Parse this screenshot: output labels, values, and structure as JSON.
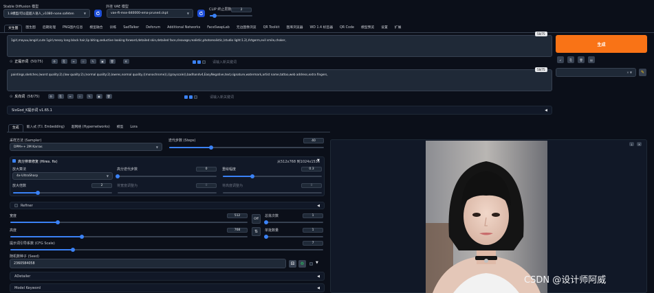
{
  "top": {
    "sd_model_label": "Stable Diffusion 模型",
    "sd_model_value": "1.8模型/可以是超人语人_v1080-none.safeten",
    "vae_label": "外挂 VAE 模型",
    "vae_value": "vae-ft-mse-840000-ema-pruned.ckpt",
    "clip_label": "CLIP 终止层数",
    "clip_value": "2"
  },
  "tabs": [
    "文生图",
    "图生图",
    "后期处理",
    "PNG图片信息",
    "模型融合",
    "训练",
    "SadTalker",
    "Deforum",
    "Additional Networks",
    "FaceSwapLab",
    "无边图像浏览",
    "QR Toolkit",
    "图库浏览器",
    "WD 1.4 标签器",
    "QR Code",
    "模型预览",
    "设置",
    "扩展"
  ],
  "prompt": {
    "text": "1girl,mayuu,longirl,cute 1girl,messy long black hair,lip biting,seductive looking forward,detailed skin,detailed face,cleavage,realistic,photorealistic,(studio light:1.2),Artgerm,evil smile,choker,",
    "counter": "58/75",
    "label": "正提示词",
    "token_info": "(50/75)",
    "extra_placeholder": "请输入新关键词"
  },
  "negative": {
    "text": "paintings,sketches,(worst quality:2),(low quality:2),(normal quality:2),lowres,normal quality,((monochrome)),((grayscale)),badhandv4,EasyNegative,text,signature,watermark,artist name,tattoo,web address,extra fingers,",
    "counter": "58/75",
    "label": "反向词",
    "token_info": "(58/75)",
    "extra_placeholder": "请输入新关键词"
  },
  "generate_label": "生成",
  "style_row": {
    "label": "SixGod_K提示词 v1.65.1"
  },
  "subtabs": [
    "生成",
    "嵌入式 (T.I. Embedding)",
    "超网络 (Hypernetworks)",
    "模型",
    "Lora"
  ],
  "sampler": {
    "label": "采样方法 (Sampler)",
    "value": "DPM++ 2M Karras"
  },
  "steps": {
    "label": "迭代步数 (Steps)",
    "value": "40",
    "fraction": 0.27
  },
  "hires": {
    "label": "高分辨率修复 (Hires. fix)",
    "summary": "从512x768 到1024x1536",
    "upscaler_label": "放大算法",
    "upscaler_value": "4x-UltraSharp",
    "hires_steps_label": "高分迭代步数",
    "hires_steps_value": "0",
    "hires_steps_fraction": 0.0,
    "denoise_label": "重绘幅度",
    "denoise_value": "0.3",
    "denoise_fraction": 0.3,
    "scale_label": "放大倍数",
    "scale_value": "2",
    "scale_fraction": 0.25,
    "width_label": "将宽度调整为",
    "width_value": "0",
    "height_label": "将高度调整为",
    "height_value": "0"
  },
  "refiner": {
    "label": "Refiner"
  },
  "width": {
    "label": "宽度",
    "value": "512",
    "fraction": 0.2
  },
  "height": {
    "label": "高度",
    "value": "768",
    "fraction": 0.3
  },
  "batch_count": {
    "label": "总批次数",
    "value": "1"
  },
  "batch_size": {
    "label": "单批数量",
    "value": "1"
  },
  "swap_label": "Off",
  "cfg": {
    "label": "提示词引导系数 (CFG Scale)",
    "value": "7",
    "fraction": 0.2
  },
  "seed": {
    "label": "随机数种子 (Seed)",
    "value": "2360584058"
  },
  "adetailer_label": "ADetailer",
  "model_keyword_label": "Model Keyword",
  "watermark": "CSDN @设计师阿威",
  "colors": {
    "accent": "#3b82f6",
    "generate": "#f97316",
    "bg": "#0b0f19"
  }
}
